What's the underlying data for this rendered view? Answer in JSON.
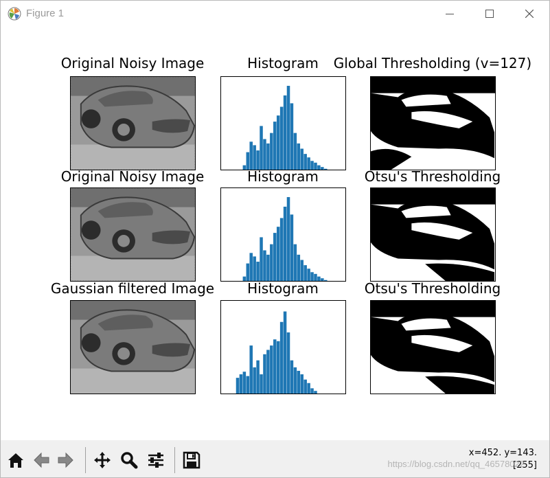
{
  "window": {
    "title": "Figure 1"
  },
  "titlebar": {
    "icons": [
      "matplotlib-logo-icon",
      "minimize-icon",
      "maximize-icon",
      "close-icon"
    ]
  },
  "subplots": [
    {
      "title": "Original Noisy Image",
      "kind": "photo"
    },
    {
      "title": "Histogram",
      "kind": "histogram"
    },
    {
      "title": "Global Thresholding (v=127)",
      "kind": "binary"
    },
    {
      "title": "Original Noisy Image",
      "kind": "photo"
    },
    {
      "title": "Histogram",
      "kind": "histogram"
    },
    {
      "title": "Otsu's Thresholding",
      "kind": "binary"
    },
    {
      "title": "Gaussian filtered Image",
      "kind": "photo"
    },
    {
      "title": "Histogram",
      "kind": "histogram"
    },
    {
      "title": "Otsu's Thresholding",
      "kind": "binary"
    }
  ],
  "chart_data": [
    {
      "type": "bar",
      "title": "Histogram",
      "xlim": [
        0,
        255
      ],
      "color": "#1f77b4",
      "x": [
        0,
        8,
        16,
        24,
        32,
        40,
        48,
        56,
        64,
        72,
        80,
        88,
        96,
        104,
        112,
        120,
        128,
        136,
        144,
        152,
        160,
        168,
        176,
        184,
        192,
        200,
        208,
        216,
        224,
        232,
        240,
        248
      ],
      "values": [
        0,
        0,
        0,
        0,
        0.05,
        0.2,
        0.32,
        0.28,
        0.22,
        0.5,
        0.35,
        0.3,
        0.42,
        0.55,
        0.62,
        0.72,
        0.85,
        0.96,
        0.76,
        0.42,
        0.3,
        0.24,
        0.18,
        0.14,
        0.1,
        0.08,
        0.05,
        0.03,
        0.01,
        0,
        0,
        0
      ]
    },
    {
      "type": "bar",
      "title": "Histogram",
      "xlim": [
        0,
        255
      ],
      "color": "#1f77b4",
      "x": [
        0,
        8,
        16,
        24,
        32,
        40,
        48,
        56,
        64,
        72,
        80,
        88,
        96,
        104,
        112,
        120,
        128,
        136,
        144,
        152,
        160,
        168,
        176,
        184,
        192,
        200,
        208,
        216,
        224,
        232,
        240,
        248
      ],
      "values": [
        0,
        0,
        0,
        0,
        0.05,
        0.2,
        0.32,
        0.28,
        0.22,
        0.5,
        0.35,
        0.3,
        0.42,
        0.55,
        0.62,
        0.72,
        0.85,
        0.96,
        0.76,
        0.42,
        0.3,
        0.24,
        0.18,
        0.14,
        0.1,
        0.08,
        0.05,
        0.03,
        0.01,
        0,
        0,
        0
      ]
    },
    {
      "type": "bar",
      "title": "Histogram",
      "xlim": [
        0,
        255
      ],
      "color": "#1f77b4",
      "x": [
        0,
        8,
        16,
        24,
        32,
        40,
        48,
        56,
        64,
        72,
        80,
        88,
        96,
        104,
        112,
        120,
        128,
        136,
        144,
        152,
        160,
        168,
        176,
        184,
        192,
        200,
        208,
        216,
        224,
        232,
        240,
        248
      ],
      "values": [
        0,
        0,
        0.18,
        0.22,
        0.25,
        0.2,
        0.55,
        0.3,
        0.38,
        0.22,
        0.45,
        0.5,
        0.55,
        0.62,
        0.6,
        0.82,
        0.94,
        0.7,
        0.38,
        0.3,
        0.26,
        0.22,
        0.16,
        0.12,
        0.06,
        0.03,
        0,
        0,
        0,
        0,
        0,
        0
      ]
    }
  ],
  "toolbar": {
    "buttons": [
      "home-icon",
      "back-icon",
      "forward-icon",
      "pan-icon",
      "zoom-icon",
      "configure-subplots-icon",
      "save-icon"
    ],
    "coords_line1": "x=452. y=143.",
    "coords_line2": "[255]",
    "watermark": "https://blog.csdn.net/qq_46578022"
  }
}
